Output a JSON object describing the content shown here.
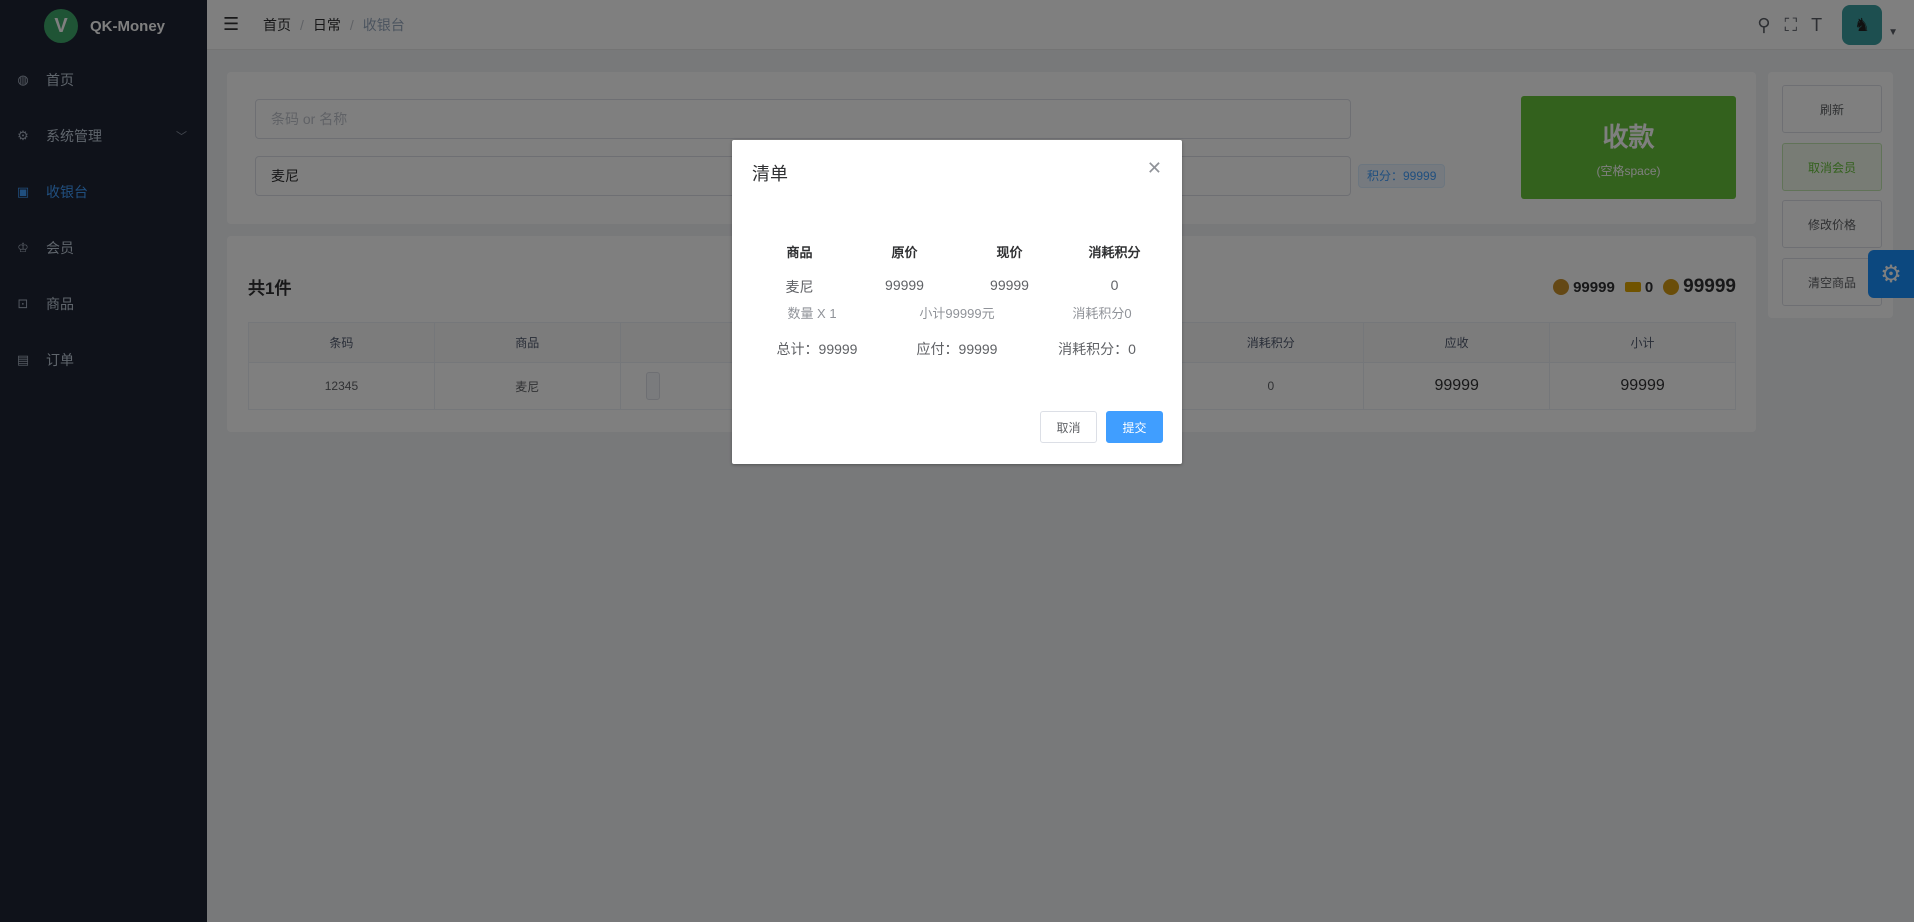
{
  "app": {
    "logo_letter": "V",
    "name": "QK-Money"
  },
  "sidebar": {
    "items": [
      {
        "label": "首页",
        "icon": "dashboard-icon"
      },
      {
        "label": "系统管理",
        "icon": "gear-icon"
      },
      {
        "label": "收银台",
        "icon": "cashier-icon",
        "active": true
      },
      {
        "label": "会员",
        "icon": "crown-icon"
      },
      {
        "label": "商品",
        "icon": "goods-icon"
      },
      {
        "label": "订单",
        "icon": "order-icon"
      }
    ]
  },
  "header": {
    "breadcrumb": [
      "首页",
      "日常",
      "收银台"
    ],
    "breadcrumb_sep": "/"
  },
  "search": {
    "placeholder": "条码 or 名称",
    "member_value": "麦尼",
    "points_tag": "积分：99999"
  },
  "pay": {
    "label": "收款",
    "hint": "(空格space)"
  },
  "side_actions": [
    "刷新",
    "取消会员",
    "修改价格",
    "清空商品"
  ],
  "list": {
    "total_label": "共1件",
    "stats": {
      "money": "99999",
      "coupon": "0",
      "coin": "99999"
    },
    "columns": [
      "条码",
      "商品",
      "",
      "",
      "",
      "消耗积分",
      "应收",
      "小计"
    ],
    "rows": [
      [
        "12345",
        "麦尼",
        "",
        "",
        "",
        "0",
        "99999",
        "99999"
      ]
    ]
  },
  "dialog": {
    "title": "清单",
    "columns": [
      "商品",
      "原价",
      "现价",
      "消耗积分"
    ],
    "item": [
      "麦尼",
      "99999",
      "99999",
      "0"
    ],
    "sub": [
      "数量 X 1",
      "小计99999元",
      "消耗积分0"
    ],
    "totals": [
      "总计：99999",
      "应付：99999",
      "消耗积分：0"
    ],
    "cancel_label": "取消",
    "submit_label": "提交"
  },
  "colors": {
    "sidebar_bg": "#1f2535",
    "primary": "#409eff",
    "success": "#67c23a"
  }
}
